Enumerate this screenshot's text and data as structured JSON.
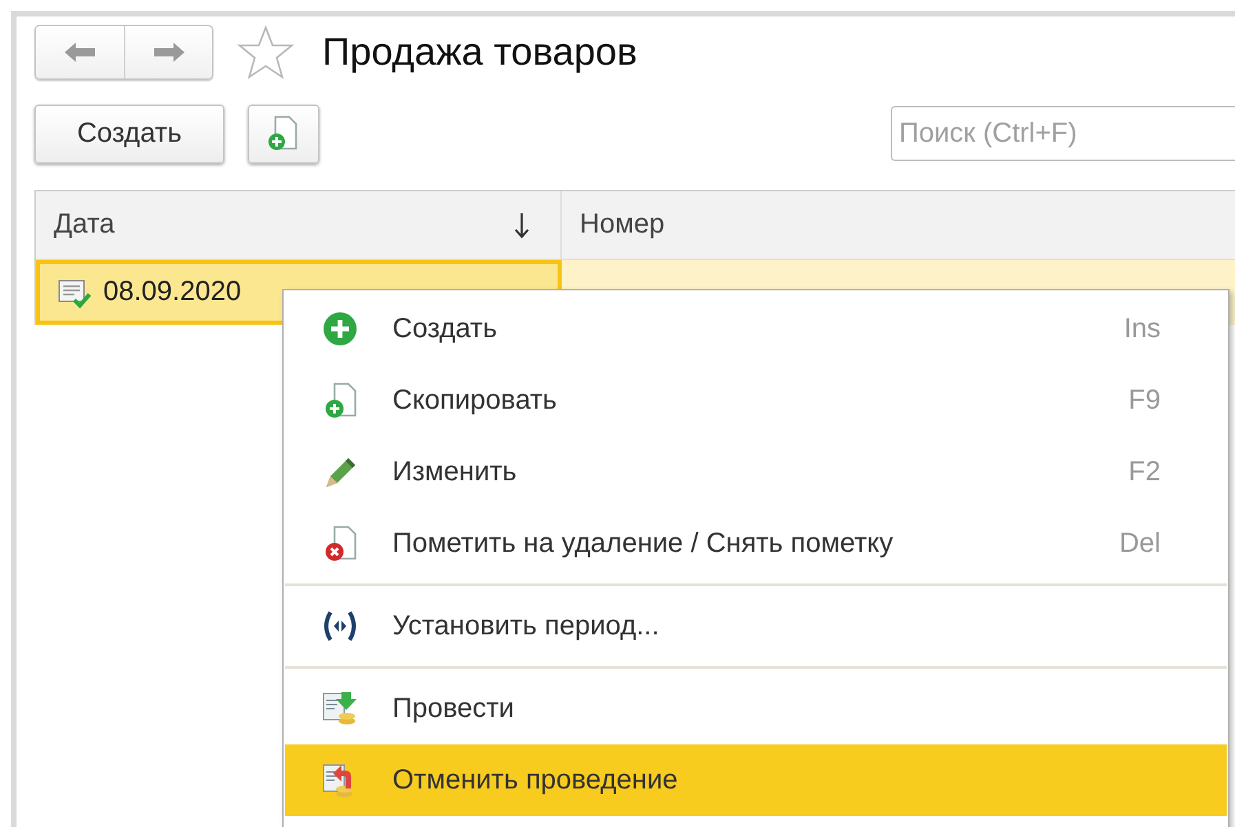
{
  "window": {
    "title": "Продажа товаров",
    "favorite": false
  },
  "toolbar": {
    "create_button": "Создать",
    "search": {
      "placeholder": "Поиск (Ctrl+F)"
    }
  },
  "table": {
    "columns": [
      {
        "label": "Дата",
        "sorted": true
      },
      {
        "label": "Номер",
        "sorted": false
      }
    ],
    "rows": [
      {
        "selected": true,
        "posted": true,
        "cells": [
          "08.09.2020"
        ]
      }
    ]
  },
  "context_menu": {
    "items": [
      {
        "kind": "command",
        "label": "Создать",
        "shortcut": "Ins",
        "selected": false
      },
      {
        "kind": "command",
        "label": "Скопировать",
        "shortcut": "F9",
        "selected": false
      },
      {
        "kind": "command",
        "label": "Изменить",
        "shortcut": "F2",
        "selected": false
      },
      {
        "kind": "command",
        "label": "Пометить на удаление / Снять пометку",
        "shortcut": "Del",
        "selected": false
      },
      {
        "kind": "separator"
      },
      {
        "kind": "command",
        "label": "Установить период...",
        "selected": false
      },
      {
        "kind": "separator"
      },
      {
        "kind": "command",
        "label": "Провести",
        "selected": false
      },
      {
        "kind": "command",
        "label": "Отменить проведение",
        "selected": true
      }
    ]
  }
}
